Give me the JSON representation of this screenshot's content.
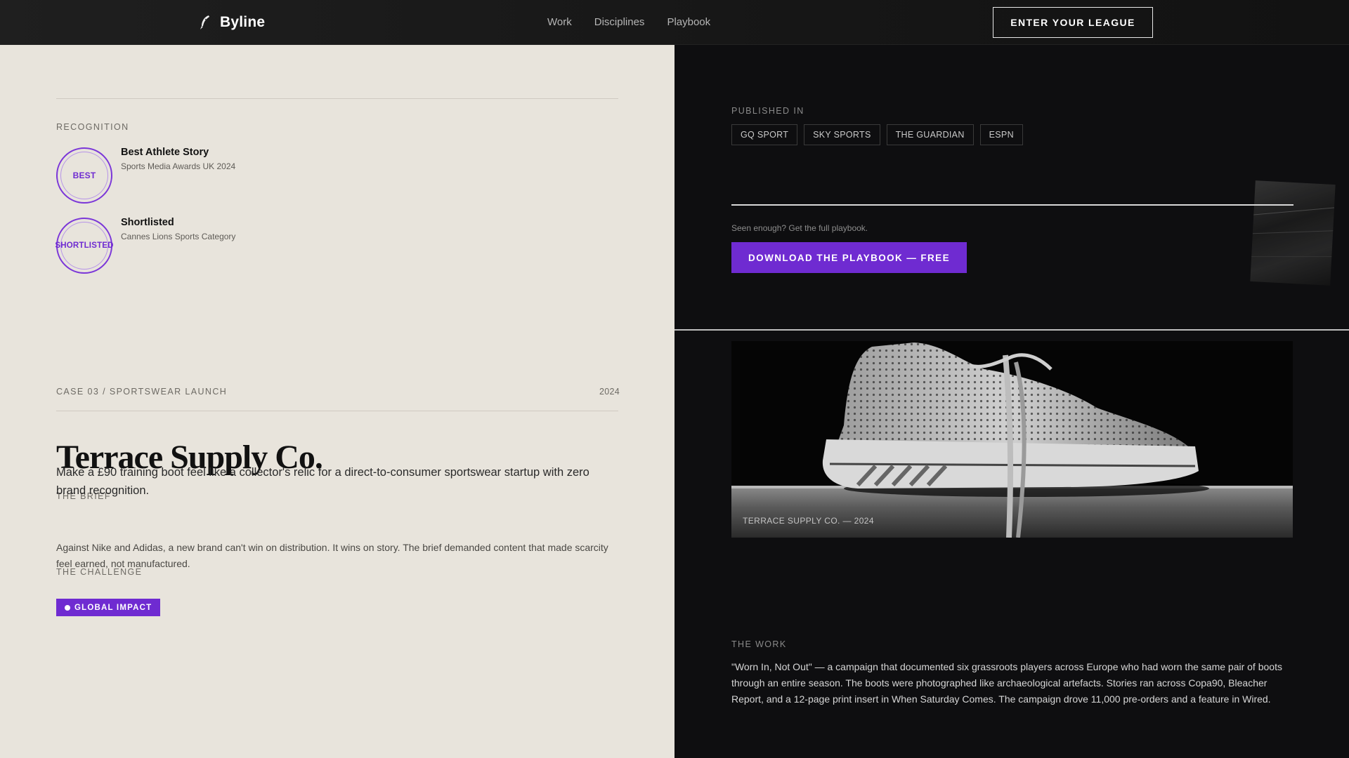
{
  "nav": {
    "brand": "Byline",
    "brand_icon": "quill-icon",
    "links": [
      "Work",
      "Disciplines",
      "Playbook"
    ],
    "cta": "ENTER YOUR LEAGUE"
  },
  "recognition": {
    "label": "RECOGNITION",
    "awards": [
      {
        "badge": "BEST",
        "title": "Best Athlete Story",
        "subtitle": "Sports Media Awards UK 2024"
      },
      {
        "badge": "SHORTLISTED",
        "title": "Shortlisted",
        "subtitle": "Cannes Lions Sports Category"
      }
    ]
  },
  "case": {
    "eyebrow": "CASE 03 / SPORTSWEAR LAUNCH",
    "year": "2024",
    "title": "Terrace Supply Co.",
    "brief_label": "THE BRIEF",
    "brief": "Make a £90 training boot feel like a collector's relic for a direct-to-consumer sportswear startup with zero brand recognition.",
    "challenge_label": "THE CHALLENGE",
    "challenge": "Against Nike and Adidas, a new brand can't win on distribution. It wins on story. The brief demanded content that made scarcity feel earned, not manufactured.",
    "impact_tag": "GLOBAL IMPACT"
  },
  "published": {
    "label": "PUBLISHED IN",
    "outlets": [
      "GQ SPORT",
      "SKY SPORTS",
      "THE GUARDIAN",
      "ESPN"
    ]
  },
  "playbook": {
    "prompt": "Seen enough? Get the full playbook.",
    "button": "DOWNLOAD THE PLAYBOOK — FREE"
  },
  "hero": {
    "caption": "TERRACE SUPPLY CO. — 2024"
  },
  "work": {
    "label": "THE WORK",
    "text": "\"Worn In, Not Out\" — a campaign that documented six grassroots players across Europe who had worn the same pair of boots through an entire season. The boots were photographed like archaeological artefacts. Stories ran across Copa90, Bleacher Report, and a 12-page print insert in When Saturday Comes. The campaign drove 11,000 pre-orders and a feature in Wired."
  },
  "colors": {
    "accent": "#6f2bd1",
    "paper": "#e8e4dc",
    "dark": "#0e0e10"
  }
}
